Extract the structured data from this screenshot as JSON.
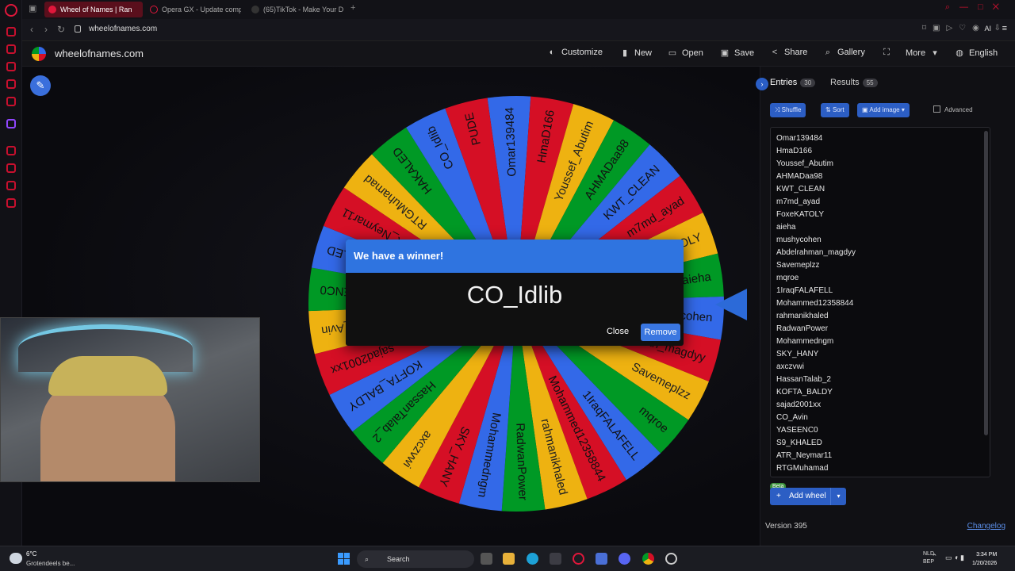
{
  "browser": {
    "tabs": [
      {
        "title": "Wheel of Names | Ran",
        "active": true
      },
      {
        "title": "Opera GX - Update comp",
        "active": false
      },
      {
        "title": "(65)TikTok - Make Your D",
        "active": false
      }
    ],
    "new_tab": "+",
    "url": "wheelofnames.com",
    "ai_label": "AI"
  },
  "site": {
    "title": "wheelofnames.com",
    "menu": [
      {
        "label": "Customize",
        "icon": "palette-icon"
      },
      {
        "label": "New",
        "icon": "file-icon"
      },
      {
        "label": "Open",
        "icon": "folder-icon"
      },
      {
        "label": "Save",
        "icon": "save-icon"
      },
      {
        "label": "Share",
        "icon": "share-icon"
      },
      {
        "label": "Gallery",
        "icon": "search-icon"
      },
      {
        "label": "",
        "icon": "fullscreen-icon"
      },
      {
        "label": "More",
        "icon": "chevron-down-icon"
      },
      {
        "label": "English",
        "icon": "globe-icon"
      }
    ]
  },
  "colors": {
    "accent": "#2f74e0",
    "wheel_blue": "#3369e8",
    "wheel_red": "#d50f25",
    "wheel_yellow": "#eeb211",
    "wheel_green": "#009925"
  },
  "wheel": {
    "rotation_deg": -98,
    "segments": [
      "Omar139484",
      "HmaD166",
      "Youssef_Abutim",
      "AHMADaa98",
      "KWT_CLEAN",
      "m7md_ayad",
      "FoxeKATOLY",
      "aieha",
      "mushycohen",
      "Abdelrahman_magdyy",
      "Savemeplzz",
      "mqroe",
      "1IraqFALAFELL",
      "Mohammed12358844",
      "rahmanikhaled",
      "RadwanPower",
      "Mohammedngm",
      "SKY_HANY",
      "axczvwi",
      "HassanTalab_2",
      "KOFTA_BALDY",
      "sajad2001xx",
      "CO_Avin",
      "YASEENC0",
      "S9_KHALED",
      "ATR_Neymar11",
      "RTGMuhamad",
      "HAKALED",
      "CO_Idlib",
      "PUDE"
    ]
  },
  "dialog": {
    "title": "We have a winner!",
    "winner": "CO_Idlib",
    "close_label": "Close",
    "remove_label": "Remove"
  },
  "panel": {
    "entries_label": "Entries",
    "entries_count": "30",
    "results_label": "Results",
    "results_count": "55",
    "shuffle_label": "Shuffle",
    "sort_label": "Sort",
    "add_image_label": "Add image",
    "advanced_label": "Advanced",
    "entries": [
      "Omar139484",
      "HmaD166",
      "Youssef_Abutim",
      "AHMADaa98",
      "KWT_CLEAN",
      "m7md_ayad",
      "FoxeKATOLY",
      "aieha",
      "mushycohen",
      "Abdelrahman_magdyy",
      "Savemeplzz",
      "mqroe",
      "1IraqFALAFELL",
      "Mohammed12358844",
      "rahmanikhaled",
      "RadwanPower",
      "Mohammedngm",
      "SKY_HANY",
      "axczvwi",
      "HassanTalab_2",
      "KOFTA_BALDY",
      "sajad2001xx",
      "CO_Avin",
      "YASEENC0",
      "S9_KHALED",
      "ATR_Neymar11",
      "RTGMuhamad"
    ],
    "beta_label": "Beta",
    "add_wheel_label": "Add wheel",
    "version": "Version 395",
    "changelog": "Changelog"
  },
  "taskbar": {
    "weather_temp": "6°C",
    "weather_desc": "Grotendeels be...",
    "search_placeholder": "Search",
    "lang_top": "NLD",
    "lang_bottom": "BEP",
    "time": "3:34 PM",
    "date": "1/20/2026"
  }
}
